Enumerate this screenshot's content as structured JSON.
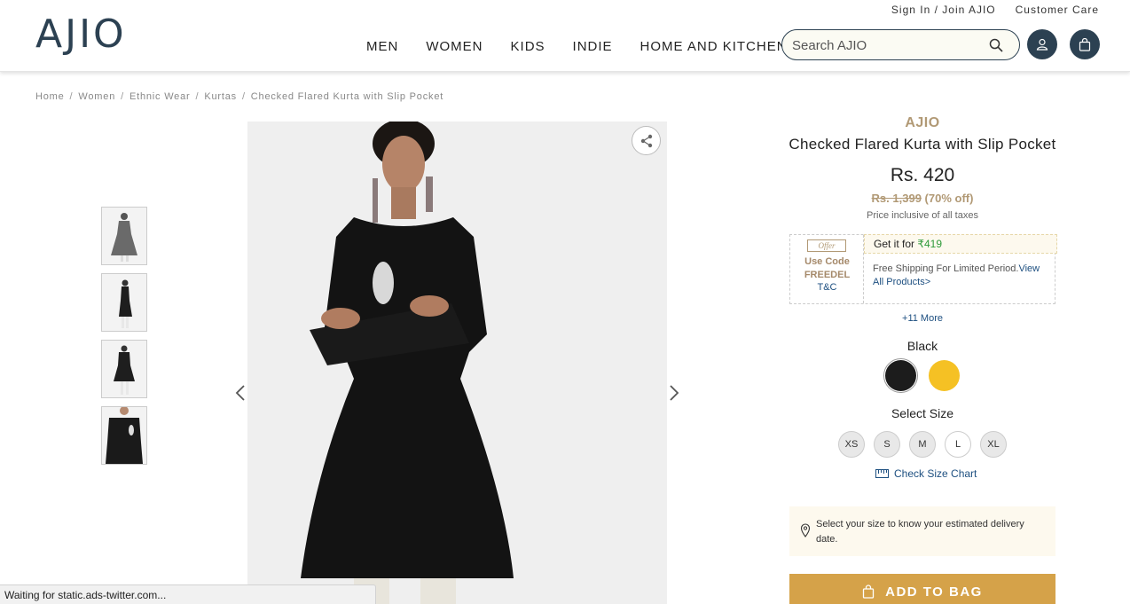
{
  "header": {
    "logo": "AJIO",
    "top_links": [
      "Sign In / Join AJIO",
      "Customer Care"
    ],
    "nav": [
      "MEN",
      "WOMEN",
      "KIDS",
      "INDIE",
      "HOME AND KITCHEN"
    ],
    "search_placeholder": "Search AJIO"
  },
  "breadcrumb": [
    "Home",
    "Women",
    "Ethnic Wear",
    "Kurtas",
    "Checked Flared Kurta with Slip Pocket"
  ],
  "product": {
    "brand": "AJIO",
    "name": "Checked Flared Kurta with Slip Pocket",
    "price": "Rs. 420",
    "mrp": "Rs. 1,399",
    "discount": "(70% off)",
    "tax_note": "Price inclusive of all taxes",
    "image_alt": "Woman wearing black flared kurta"
  },
  "offer": {
    "tag": "Offer",
    "use_code_label": "Use Code",
    "code": "FREEDEL",
    "tc": "T&C",
    "get_it_label": "Get it for",
    "get_it_price": "₹419",
    "shipping_text": "Free Shipping For Limited Period.",
    "shipping_link": "View All Products>",
    "more": "+11 More"
  },
  "colors": {
    "selected_label": "Black",
    "swatches": [
      {
        "name": "Black",
        "hex": "#1c1c1c"
      },
      {
        "name": "Yellow",
        "hex": "#f5c124"
      }
    ]
  },
  "sizes": {
    "label": "Select Size",
    "options": [
      "XS",
      "S",
      "M",
      "L",
      "XL"
    ],
    "available": [
      "L"
    ],
    "chart_link": "Check Size Chart"
  },
  "delivery": {
    "text": "Select your size to know your estimated delivery date."
  },
  "add_to_bag": "ADD TO BAG",
  "status_bar": "Waiting for static.ads-twitter.com...",
  "colors_theme": {
    "brand_navy": "#2c4152",
    "gold": "#b19975",
    "button_gold": "#d5a249",
    "link_blue": "#1d4f80",
    "offer_green": "#2e9a3a"
  }
}
